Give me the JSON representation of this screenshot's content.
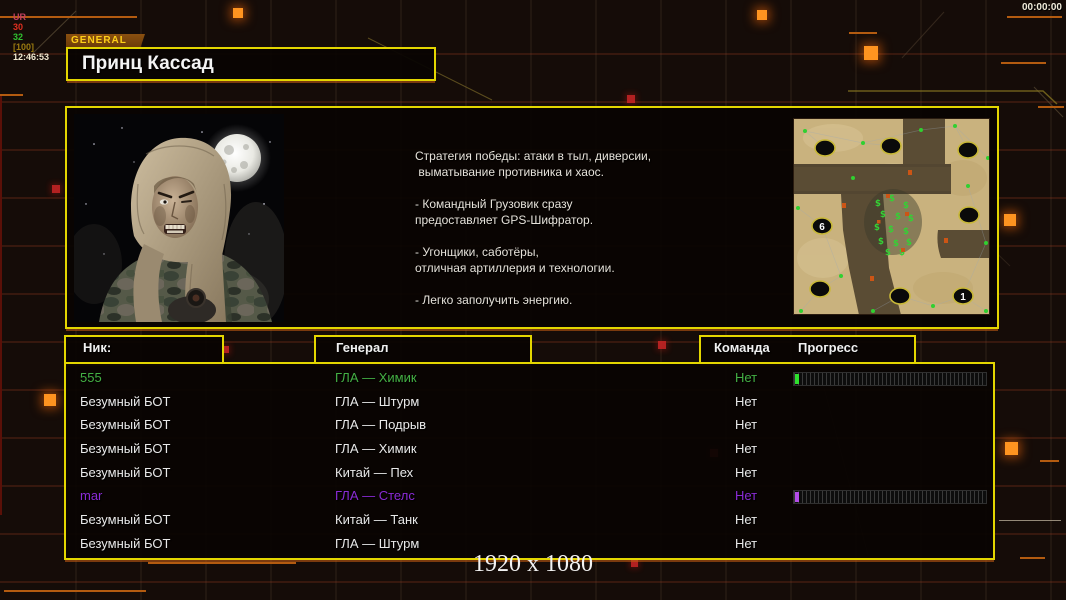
{
  "status_bar": {
    "left": {
      "label": "UR",
      "v1": "30",
      "v2": "32",
      "v3": "[100]",
      "clock": "12:46:53"
    },
    "timer": "00:00:00"
  },
  "general_tab": "GENERAL",
  "page_title": "Принц Кассад",
  "main": {
    "strategy_lines": [
      "Стратегия победы: атаки в тыл, диверсии,",
      " выматывание противника и хаос.",
      "",
      "- Командный Грузовик сразу",
      "предоставляет GPS-Шифратор.",
      "",
      "- Угонщики, саботёры,",
      "отличная артиллерия и технологии.",
      "",
      "- Легко заполучить энергию."
    ]
  },
  "minimap": {
    "start_labels": [
      "6",
      "1"
    ]
  },
  "table": {
    "headers": {
      "nick": "Ник:",
      "general": "Генерал",
      "team": "Команда",
      "progress": "Прогресс"
    },
    "rows": [
      {
        "nick": "555",
        "general": "ГЛА — Химик",
        "team": "Нет",
        "color": "#44b044",
        "has_progress_bar": true,
        "progress_pct": 2,
        "fill_color": "#2ee02e"
      },
      {
        "nick": "Безумный БОТ",
        "general": "ГЛА — Штурм",
        "team": "Нет",
        "color": "#e9e9e9",
        "has_progress_bar": false,
        "progress_pct": 0,
        "fill_color": ""
      },
      {
        "nick": "Безумный БОТ",
        "general": "ГЛА — Подрыв",
        "team": "Нет",
        "color": "#e9e9e9",
        "has_progress_bar": false,
        "progress_pct": 0,
        "fill_color": ""
      },
      {
        "nick": "Безумный БОТ",
        "general": "ГЛА — Химик",
        "team": "Нет",
        "color": "#e9e9e9",
        "has_progress_bar": false,
        "progress_pct": 0,
        "fill_color": ""
      },
      {
        "nick": "Безумный БОТ",
        "general": "Китай — Пех",
        "team": "Нет",
        "color": "#e9e9e9",
        "has_progress_bar": false,
        "progress_pct": 0,
        "fill_color": ""
      },
      {
        "nick": "mar",
        "general": "ГЛА — Стелс",
        "team": "Нет",
        "color": "#8a2bd6",
        "has_progress_bar": true,
        "progress_pct": 2,
        "fill_color": "#b44ce8"
      },
      {
        "nick": "Безумный БОТ",
        "general": "Китай — Танк",
        "team": "Нет",
        "color": "#e9e9e9",
        "has_progress_bar": false,
        "progress_pct": 0,
        "fill_color": ""
      },
      {
        "nick": "Безумный БОТ",
        "general": "ГЛА — Штурм",
        "team": "Нет",
        "color": "#e9e9e9",
        "has_progress_bar": false,
        "progress_pct": 0,
        "fill_color": ""
      }
    ]
  },
  "footer": {
    "resolution": "1920 x 1080"
  },
  "colors": {
    "accent_yellow": "#e3d600",
    "accent_orange": "#ff9420",
    "status_label": "#c04060",
    "status_v1": "#e03020",
    "status_v2": "#30c030",
    "status_v3": "#9a7a10",
    "status_clock": "#f0e8d0"
  }
}
